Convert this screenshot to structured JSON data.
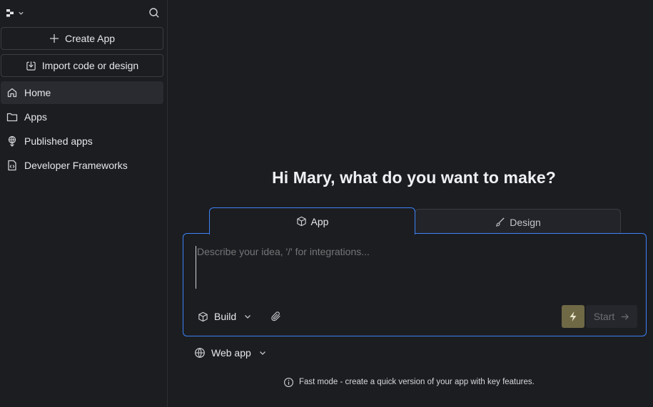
{
  "sidebar": {
    "create_app_label": "Create App",
    "import_label": "Import code or design",
    "items": [
      {
        "label": "Home",
        "icon": "home-icon",
        "active": true
      },
      {
        "label": "Apps",
        "icon": "folder-icon"
      },
      {
        "label": "Published apps",
        "icon": "published-icon"
      },
      {
        "label": "Developer Frameworks",
        "icon": "code-file-icon"
      }
    ]
  },
  "main": {
    "headline": "Hi Mary, what do you want to make?",
    "tabs": [
      {
        "label": "App",
        "icon": "cube-icon",
        "selected": true
      },
      {
        "label": "Design",
        "icon": "brush-icon"
      }
    ],
    "prompt_placeholder": "Describe your idea, '/' for integrations...",
    "build_label": "Build",
    "start_label": "Start",
    "target_label": "Web app",
    "info_text": "Fast mode - create a quick version of your app with key features."
  },
  "colors": {
    "background": "#1c1d21",
    "accent_blue": "#3b82f6",
    "fast_mode": "#6f6945",
    "border": "#3a3c42"
  }
}
